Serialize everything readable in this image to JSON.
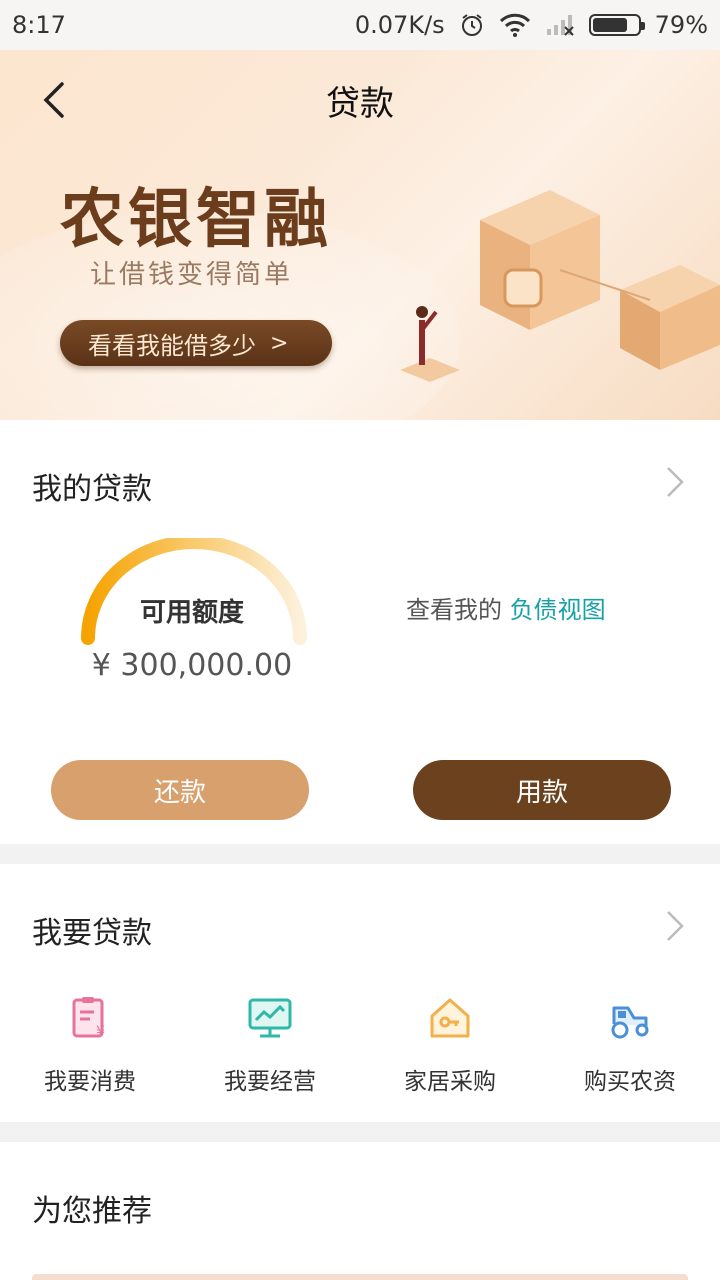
{
  "status_bar": {
    "time": "8:17",
    "network_speed": "0.07K/s",
    "battery_percent": "79%",
    "battery_level": 0.79,
    "icons": [
      "alarm-icon",
      "wifi-icon",
      "signal-icon",
      "battery-icon"
    ]
  },
  "header": {
    "title": "贷款",
    "back_icon": "back-arrow-icon"
  },
  "banner": {
    "brand": "农银智融",
    "slogan": "让借钱变得简单",
    "cta_label": "看看我能借多少",
    "cta_arrow": ">"
  },
  "my_loan": {
    "title": "我的贷款",
    "gauge_label": "可用额度",
    "amount": "¥ 300,000.00",
    "debt_prefix": "查看我的",
    "debt_link": "负债视图",
    "repay_label": "还款",
    "use_label": "用款"
  },
  "want_loan": {
    "title": "我要贷款",
    "items": [
      {
        "label": "我要消费",
        "icon": "consumption-icon",
        "color": "#e8739a"
      },
      {
        "label": "我要经营",
        "icon": "business-chart-icon",
        "color": "#2fb8a8"
      },
      {
        "label": "家居采购",
        "icon": "home-key-icon",
        "color": "#f2b04a"
      },
      {
        "label": "购买农资",
        "icon": "tractor-icon",
        "color": "#4a90d8"
      }
    ]
  },
  "recommend": {
    "title": "为您推荐"
  },
  "colors": {
    "brand_brown": "#6b421d",
    "repay_tan": "#d7a06c",
    "link_teal": "#18a0a6",
    "gauge_start": "#f5a300",
    "gauge_end": "#fdf1dc"
  }
}
